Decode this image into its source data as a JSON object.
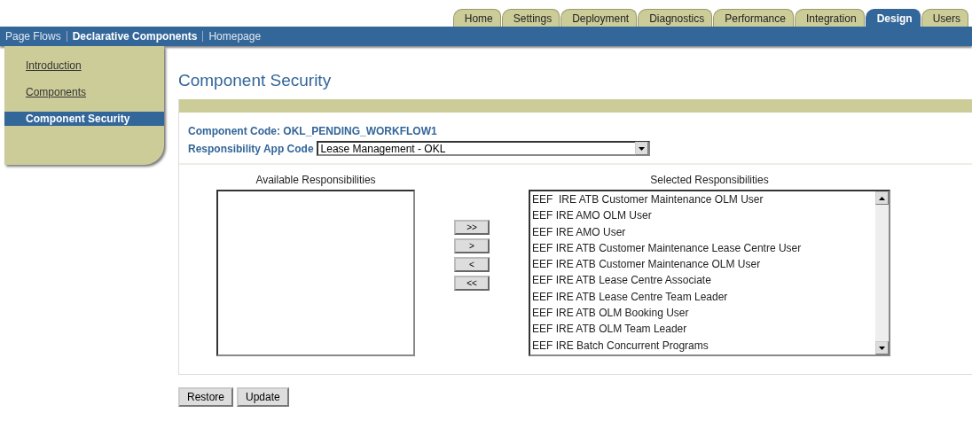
{
  "tabs": [
    {
      "label": "Home",
      "selected": false
    },
    {
      "label": "Settings",
      "selected": false
    },
    {
      "label": "Deployment",
      "selected": false
    },
    {
      "label": "Diagnostics",
      "selected": false
    },
    {
      "label": "Performance",
      "selected": false
    },
    {
      "label": "Integration",
      "selected": false
    },
    {
      "label": "Design",
      "selected": true
    },
    {
      "label": "Users",
      "selected": false
    }
  ],
  "subnav": [
    {
      "label": "Page Flows",
      "selected": false
    },
    {
      "label": "Declarative Components",
      "selected": true
    },
    {
      "label": "Homepage",
      "selected": false
    }
  ],
  "sidebar": {
    "items": [
      {
        "label": "Introduction",
        "selected": false
      },
      {
        "label": "Components",
        "selected": false
      },
      {
        "label": "Component Security",
        "selected": true
      }
    ]
  },
  "page_title": "Component Security",
  "component_code": "Component Code: OKL_PENDING_WORKFLOW1",
  "app_code": {
    "label": "Responsibility App Code",
    "value": "Lease Management - OKL"
  },
  "available": {
    "heading": "Available Responsibilities"
  },
  "move_buttons": [
    ">>",
    ">",
    "<",
    "<<"
  ],
  "selected_list": {
    "heading": "Selected Responsibilities",
    "items": [
      "EEF  IRE ATB Customer Maintenance OLM User",
      "EEF IRE AMO OLM User",
      "EEF IRE AMO User",
      "EEF IRE ATB Customer Maintenance Lease Centre User",
      "EEF IRE ATB Customer Maintenance OLM User",
      "EEF IRE ATB Lease Centre Associate",
      "EEF IRE ATB Lease Centre Team Leader",
      "EEF IRE ATB OLM Booking User",
      "EEF IRE ATB OLM Team Leader",
      "EEF IRE Batch Concurrent Programs"
    ]
  },
  "actions": [
    "Restore",
    "Update"
  ]
}
